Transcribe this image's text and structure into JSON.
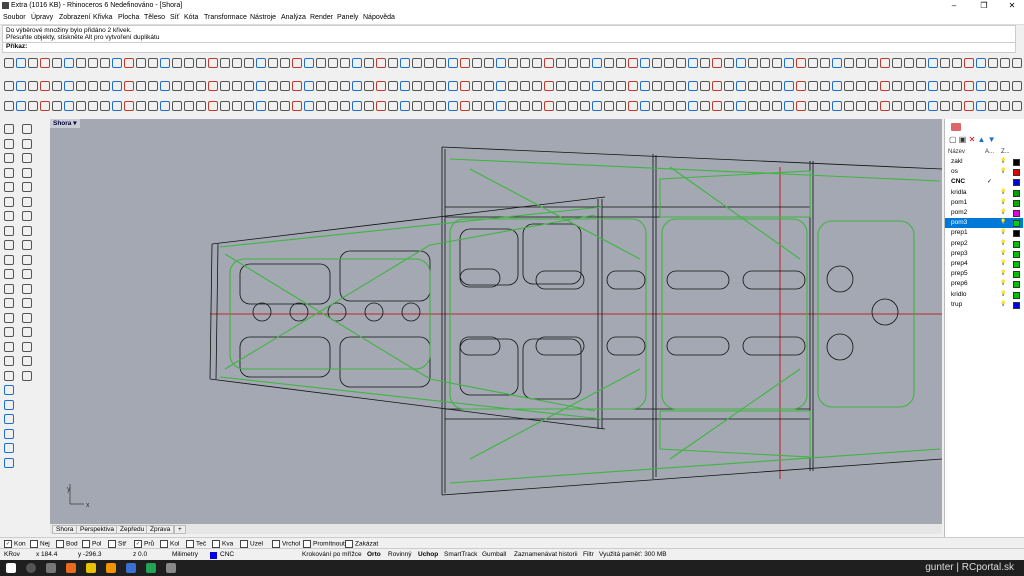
{
  "window": {
    "title": "Extra (1016 KB) - Rhinoceros 6 Nedefinováno - [Shora]",
    "minimize": "–",
    "maximize": "❐",
    "close": "✕"
  },
  "menu": [
    "Soubor",
    "Úpravy",
    "Zobrazení",
    "Křivka",
    "Plocha",
    "Těleso",
    "Síť",
    "Kóta",
    "Transformace",
    "Nástroje",
    "Analýza",
    "Render",
    "Panely",
    "Nápověda"
  ],
  "command": {
    "history": [
      "Do výběrové množiny bylo přidáno 2 křivek.",
      "Přesuňte objekty, stiskněte Alt pro vytvoření duplikátu"
    ],
    "prompt": "Příkaz:"
  },
  "viewport": {
    "name": "Shora",
    "axis_y": "y",
    "axis_x": "x"
  },
  "viewport_tabs": [
    "Shora",
    "Perspektiva",
    "Zepředu",
    "Zprava",
    "+"
  ],
  "layers": {
    "header_name": "Název",
    "header_a": "A...",
    "header_z": "Z...",
    "rows": [
      {
        "name": "zakl",
        "color": "#000000",
        "current": false,
        "selected": false
      },
      {
        "name": "os",
        "color": "#e00000",
        "current": false,
        "selected": false
      },
      {
        "name": "CNC",
        "color": "#0000e0",
        "current": true,
        "selected": false
      },
      {
        "name": "kridla",
        "color": "#00a000",
        "current": false,
        "selected": false
      },
      {
        "name": "pom1",
        "color": "#00b000",
        "current": false,
        "selected": false
      },
      {
        "name": "pom2",
        "color": "#e000e0",
        "current": false,
        "selected": false
      },
      {
        "name": "pom3",
        "color": "#00d000",
        "current": false,
        "selected": true
      },
      {
        "name": "prep1",
        "color": "#000000",
        "current": false,
        "selected": false
      },
      {
        "name": "prep2",
        "color": "#00c000",
        "current": false,
        "selected": false
      },
      {
        "name": "prep3",
        "color": "#00c000",
        "current": false,
        "selected": false
      },
      {
        "name": "prep4",
        "color": "#00c000",
        "current": false,
        "selected": false
      },
      {
        "name": "prep5",
        "color": "#00c000",
        "current": false,
        "selected": false
      },
      {
        "name": "prep6",
        "color": "#00c000",
        "current": false,
        "selected": false
      },
      {
        "name": "kridlo",
        "color": "#00c000",
        "current": false,
        "selected": false
      },
      {
        "name": "trup",
        "color": "#0000e0",
        "current": false,
        "selected": false
      }
    ],
    "check": "✓"
  },
  "osnap": [
    {
      "label": "Kon",
      "checked": true
    },
    {
      "label": "Nej",
      "checked": false
    },
    {
      "label": "Bod",
      "checked": false
    },
    {
      "label": "Pol",
      "checked": false
    },
    {
      "label": "Stř",
      "checked": false
    },
    {
      "label": "Prů",
      "checked": true
    },
    {
      "label": "Kol",
      "checked": false
    },
    {
      "label": "Teč",
      "checked": false
    },
    {
      "label": "Kva",
      "checked": false
    },
    {
      "label": "Uzel",
      "checked": false
    },
    {
      "label": "Vrchol",
      "checked": false
    },
    {
      "label": "Promítnout",
      "checked": false
    },
    {
      "label": "Zakázat",
      "checked": false
    }
  ],
  "status": {
    "plane": "KRov",
    "x": "x 184.4",
    "y": "y -296.3",
    "z": "z 0.0",
    "units": "Milimetry",
    "layer": "CNC",
    "layer_color": "#0000e0",
    "grid_snap": "Krokování po mřížce",
    "ortho": "Orto",
    "planar": "Rovinný",
    "osnap": "Uchop",
    "smarttrack": "SmartTrack",
    "gumball": "Gumball",
    "history": "Zaznamenávat historii",
    "filter": "Filtr",
    "memory": "Využitá paměť: 300 MB"
  },
  "taskbar": {
    "watermark": "gunter | RCportal.sk"
  }
}
